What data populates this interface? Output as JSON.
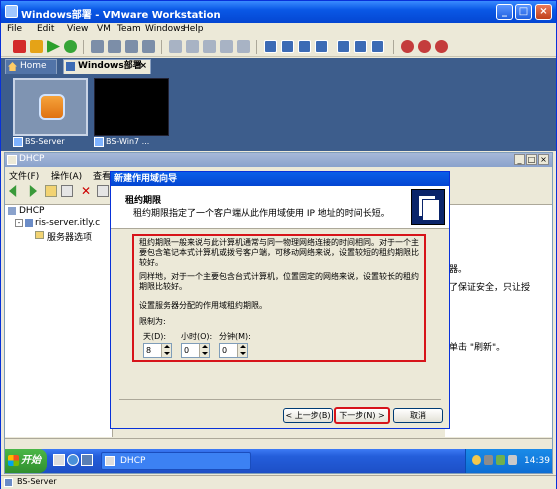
{
  "vmware": {
    "title": "Windows部署 - VMware Workstation",
    "menu": [
      "File",
      "Edit",
      "View",
      "VM",
      "Team",
      "Windows",
      "Help"
    ],
    "tabs": [
      {
        "label": "Home"
      },
      {
        "label": "Windows部署",
        "close": "×"
      }
    ],
    "thumbnails": [
      {
        "label": "BS-Server"
      },
      {
        "label": "BS-Win7 ..."
      }
    ],
    "status_vm": "BS-Server"
  },
  "dhcp": {
    "title": "DHCP",
    "menu": [
      "文件(F)",
      "操作(A)",
      "查看"
    ],
    "tree": [
      {
        "label": "DHCP"
      },
      {
        "label": "ris-server.itly.c"
      },
      {
        "label": "服务器选项"
      }
    ],
    "right_fragments": [
      "器。",
      "了保证安全，只让授",
      "单击 \"刷新\"。"
    ]
  },
  "wizard": {
    "title": "新建作用域向导",
    "header_title": "租约期限",
    "header_desc": "租约期限指定了一个客户端从此作用域使用 IP 地址的时间长短。",
    "para1": "租约期限一般来说与此计算机通常与同一物理网络连接的时间相同。对于一个主要包含笔记本式计算机或拨号客户端，可移动网络来说，设置较短的租约期限比较好。",
    "para2": "同样地，对于一个主要包含台式计算机，位置固定的网络来说，设置较长的租约期限比较好。",
    "para3": "设置服务器分配的作用域租约期限。",
    "limit_label": "限制为:",
    "days_label": "天(D):",
    "hours_label": "小时(O):",
    "minutes_label": "分钟(M):",
    "days_value": "8",
    "hours_value": "0",
    "minutes_value": "0",
    "back_label": "< 上一步(B)",
    "next_label": "下一步(N) >",
    "cancel_label": "取消"
  },
  "taskbar": {
    "start": "开始",
    "task": "DHCP",
    "clock": "14:39"
  }
}
